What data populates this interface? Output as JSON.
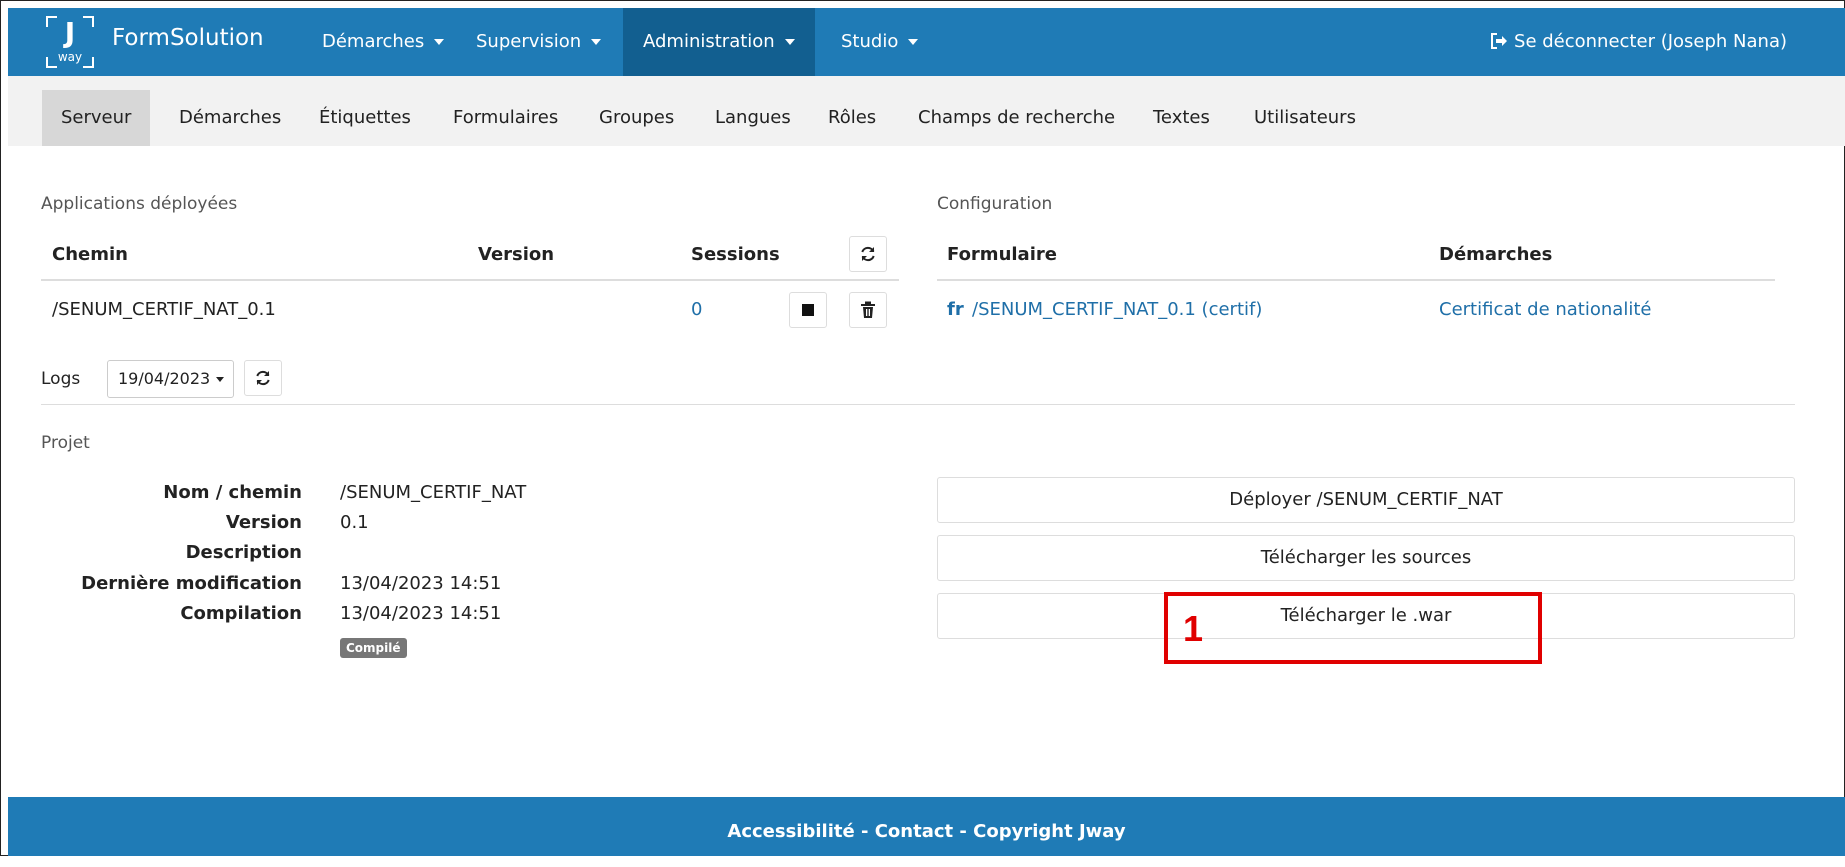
{
  "navbar": {
    "logo_letter": "J",
    "logo_sub": "way",
    "brand": "FormSolution",
    "menus": [
      "Démarches",
      "Supervision",
      "Administration",
      "Studio"
    ],
    "logout": "Se déconnecter (Joseph Nana)"
  },
  "subnav": [
    "Serveur",
    "Démarches",
    "Étiquettes",
    "Formulaires",
    "Groupes",
    "Langues",
    "Rôles",
    "Champs de recherche",
    "Textes",
    "Utilisateurs"
  ],
  "apps": {
    "title": "Applications déployées",
    "headers": {
      "path": "Chemin",
      "version": "Version",
      "sessions": "Sessions"
    },
    "row": {
      "path": "/SENUM_CERTIF_NAT_0.1",
      "version": "",
      "sessions": "0"
    }
  },
  "config": {
    "title": "Configuration",
    "headers": {
      "form": "Formulaire",
      "proc": "Démarches"
    },
    "row": {
      "form_lang": "fr",
      "form": "/SENUM_CERTIF_NAT_0.1 (certif)",
      "proc": "Certificat de nationalité"
    }
  },
  "logs": {
    "label": "Logs",
    "date": "19/04/2023"
  },
  "project": {
    "title": "Projet",
    "fields": [
      {
        "label": "Nom / chemin",
        "value": "/SENUM_CERTIF_NAT"
      },
      {
        "label": "Version",
        "value": "0.1"
      },
      {
        "label": "Description",
        "value": ""
      },
      {
        "label": "Dernière modification",
        "value": "13/04/2023 14:51"
      },
      {
        "label": "Compilation",
        "value": "13/04/2023 14:51"
      }
    ],
    "status": "Compilé"
  },
  "actions": {
    "deploy": "Déployer /SENUM_CERTIF_NAT",
    "download_sources": "Télécharger les sources",
    "download_war": "Télécharger le .war"
  },
  "annotation": {
    "number": "1",
    "color": "#e00000"
  },
  "footer": {
    "accessibility": "Accessibilité",
    "contact": "Contact",
    "copyright": "Copyright Jway",
    "sep": " - "
  },
  "colors": {
    "primary": "#1f7bb6",
    "link": "#1f6fa8"
  }
}
